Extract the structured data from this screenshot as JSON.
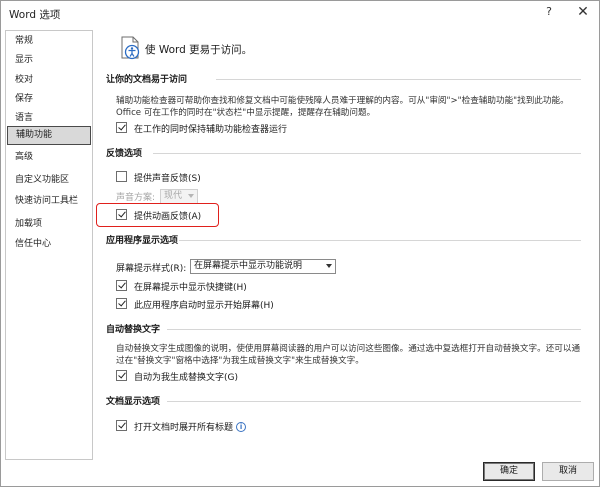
{
  "window": {
    "title": "Word 选项",
    "help_label": "?",
    "close_label": "✕"
  },
  "sidebar": {
    "items": [
      {
        "label": "常规"
      },
      {
        "label": "显示"
      },
      {
        "label": "校对"
      },
      {
        "label": "保存"
      },
      {
        "label": "语言"
      },
      {
        "label": "辅助功能",
        "selected": true
      },
      {
        "label": "高级"
      },
      {
        "label": "自定义功能区"
      },
      {
        "label": "快速访问工具栏"
      },
      {
        "label": "加载项"
      },
      {
        "label": "信任中心"
      }
    ]
  },
  "main": {
    "header_text": "使 Word 更易于访问。",
    "accessibility": {
      "title": "让你的文档易于访问",
      "description": "辅助功能检查器可帮助你查找和修复文档中可能使残障人员难于理解的内容。可从\"审阅\">\"检查辅助功能\"找到此功能。Office 可在工作的同时在\"状态栏\"中显示提醒，提醒存在辅助问题。",
      "checkbox_label": "在工作的同时保持辅助功能检查器运行",
      "checked": true
    },
    "feedback": {
      "title": "反馈选项",
      "sound_label": "提供声音反馈(S)",
      "sound_checked": false,
      "sound_scheme_label": "声音方案:",
      "sound_scheme_value": "现代",
      "animation_label": "提供动画反馈(A)",
      "animation_checked": true
    },
    "app_display": {
      "title": "应用程序显示选项",
      "screentip_label": "屏幕提示样式(R):",
      "screentip_value": "在屏幕提示中显示功能说明",
      "shortcut_label": "在屏幕提示中显示快捷键(H)",
      "shortcut_checked": true,
      "startscreen_label": "此应用程序启动时显示开始屏幕(H)",
      "startscreen_checked": true
    },
    "alt_text": {
      "title": "自动替换文字",
      "description": "自动替换文字生成图像的说明，使使用屏幕阅读器的用户可以访问这些图像。通过选中复选框打开自动替换文字。还可以通过在\"替换文字\"窗格中选择\"为我生成替换文字\"来生成替换文字。",
      "checkbox_label": "自动为我生成替换文字(G)",
      "checked": true
    },
    "doc_display": {
      "title": "文档显示选项",
      "checkbox_label": "打开文档时展开所有标题",
      "checked": true,
      "info_icon": "info-icon"
    }
  },
  "footer": {
    "ok_label": "确定",
    "cancel_label": "取消"
  },
  "colors": {
    "highlight": "#e0201c",
    "info": "#3a73c2"
  }
}
